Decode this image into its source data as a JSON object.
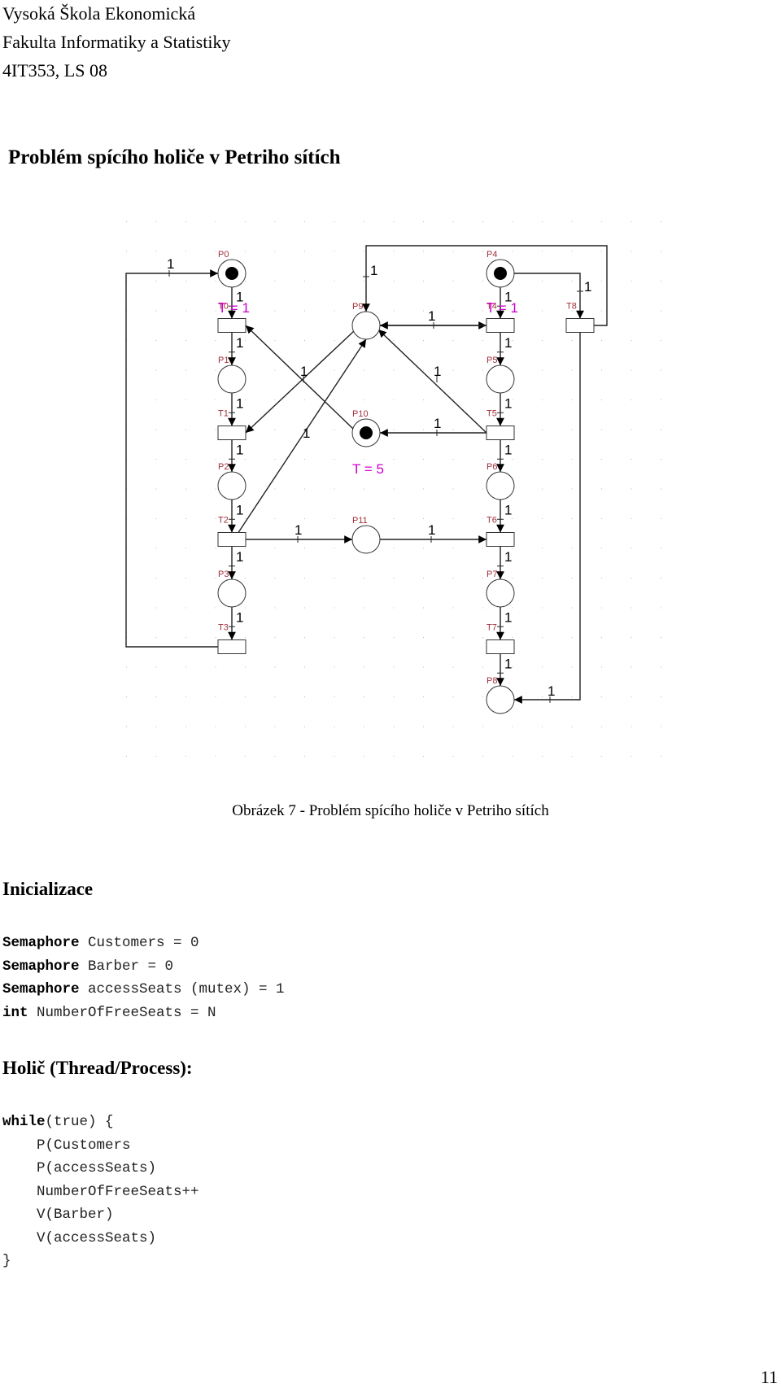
{
  "header": {
    "line1": "Vysoká Škola Ekonomická",
    "line2": "Fakulta Informatiky a Statistiky",
    "line3": "4IT353, LS 08"
  },
  "title": "Problém spícího holiče v Petriho sítích",
  "figure": {
    "caption": "Obrázek 7 - Problém spícího holiče v Petriho sítích",
    "places": [
      {
        "id": "P0",
        "tokens": 1
      },
      {
        "id": "P1",
        "tokens": 0
      },
      {
        "id": "P2",
        "tokens": 0
      },
      {
        "id": "P3",
        "tokens": 0
      },
      {
        "id": "P4",
        "tokens": 1
      },
      {
        "id": "P5",
        "tokens": 0
      },
      {
        "id": "P6",
        "tokens": 0
      },
      {
        "id": "P7",
        "tokens": 0
      },
      {
        "id": "P8",
        "tokens": 0
      },
      {
        "id": "P9",
        "tokens": 0
      },
      {
        "id": "P10",
        "tokens": 1
      },
      {
        "id": "P11",
        "tokens": 0
      }
    ],
    "transitions": [
      "T0",
      "T1",
      "T2",
      "T3",
      "T4",
      "T5",
      "T6",
      "T7",
      "T8"
    ],
    "timing_labels": [
      {
        "target": "T0",
        "text": "T = 1"
      },
      {
        "target": "T4",
        "text": "T = 1"
      },
      {
        "target": "P10",
        "text": "T = 5"
      }
    ],
    "arcs": [
      {
        "from": "P0",
        "to": "T0",
        "weight": "1"
      },
      {
        "from": "T0",
        "to": "P1",
        "weight": "1"
      },
      {
        "from": "P1",
        "to": "T1",
        "weight": "1"
      },
      {
        "from": "T1",
        "to": "P2",
        "weight": "1"
      },
      {
        "from": "P2",
        "to": "T2",
        "weight": "1"
      },
      {
        "from": "T2",
        "to": "P3",
        "weight": "1"
      },
      {
        "from": "P3",
        "to": "T3",
        "weight": "1"
      },
      {
        "from": "T3",
        "to": "P0",
        "weight": "1"
      },
      {
        "from": "P4",
        "to": "T4",
        "weight": "1"
      },
      {
        "from": "T4",
        "to": "P5",
        "weight": "1"
      },
      {
        "from": "P5",
        "to": "T5",
        "weight": "1"
      },
      {
        "from": "T5",
        "to": "P6",
        "weight": "1"
      },
      {
        "from": "P6",
        "to": "T6",
        "weight": "1"
      },
      {
        "from": "T6",
        "to": "P7",
        "weight": "1"
      },
      {
        "from": "P7",
        "to": "T7",
        "weight": "1"
      },
      {
        "from": "T7",
        "to": "P8",
        "weight": "1"
      },
      {
        "from": "P4",
        "to": "T8",
        "weight": "1"
      },
      {
        "from": "T8",
        "to": "P9",
        "weight": "1"
      },
      {
        "from": "T8",
        "to": "P8",
        "weight": "1"
      },
      {
        "from": "P9",
        "to": "T4",
        "weight": "1"
      },
      {
        "from": "T4",
        "to": "P9",
        "weight": "1"
      },
      {
        "from": "T5",
        "to": "P9",
        "weight": "1"
      },
      {
        "from": "T5",
        "to": "P10",
        "weight": "1"
      },
      {
        "from": "P10",
        "to": "T0",
        "weight": "1"
      },
      {
        "from": "P9",
        "to": "T1",
        "weight": "1"
      },
      {
        "from": "T2",
        "to": "P9",
        "weight": "1"
      },
      {
        "from": "T2",
        "to": "P11",
        "weight": "1"
      },
      {
        "from": "P11",
        "to": "T6",
        "weight": "1"
      }
    ]
  },
  "init": {
    "heading": "Inicializace",
    "lines": [
      {
        "kw": "Semaphore",
        "rest": " Customers = 0"
      },
      {
        "kw": "Semaphore",
        "rest": " Barber = 0"
      },
      {
        "kw": "Semaphore",
        "rest": " accessSeats (mutex) = 1"
      },
      {
        "kw": "int",
        "rest": " NumberOfFreeSeats = N"
      }
    ]
  },
  "barber": {
    "heading": "Holič (Thread/Process):",
    "lines": [
      {
        "kw": "while",
        "rest": "(true) {"
      },
      {
        "kw": "",
        "rest": "    P(Customers"
      },
      {
        "kw": "",
        "rest": "    P(accessSeats)"
      },
      {
        "kw": "",
        "rest": "    NumberOfFreeSeats++"
      },
      {
        "kw": "",
        "rest": "    V(Barber)"
      },
      {
        "kw": "",
        "rest": "    V(accessSeats)"
      },
      {
        "kw": "",
        "rest": "}"
      }
    ]
  },
  "page_number": "11"
}
